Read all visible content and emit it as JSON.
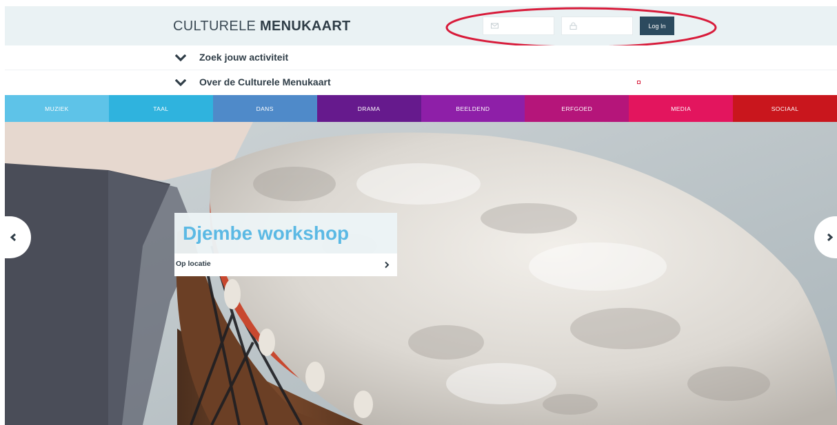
{
  "header": {
    "logo_light": "CULTURELE",
    "logo_bold": "MENUKAART",
    "login": {
      "email_icon": "envelope-icon",
      "password_icon": "lock-icon",
      "button_label": "Log In"
    }
  },
  "accordion": [
    {
      "label": "Zoek jouw activiteit",
      "icon": "chevron-down-icon"
    },
    {
      "label": "Over de Culturele Menukaart",
      "icon": "chevron-down-icon"
    }
  ],
  "categories": [
    {
      "label": "MUZIEK",
      "color": "#5ec3e8"
    },
    {
      "label": "TAAL",
      "color": "#2fb3de"
    },
    {
      "label": "DANS",
      "color": "#4f8ac9"
    },
    {
      "label": "DRAMA",
      "color": "#661a8d"
    },
    {
      "label": "BEELDEND",
      "color": "#8e1fa8"
    },
    {
      "label": "ERFGOED",
      "color": "#b5157a"
    },
    {
      "label": "MEDIA",
      "color": "#e3155e"
    },
    {
      "label": "SOCIAAL",
      "color": "#c9161d"
    }
  ],
  "hero": {
    "title": "Djembe workshop",
    "link_label": "Op locatie",
    "prev_icon": "chevron-left-icon",
    "next_icon": "chevron-right-icon"
  },
  "colors": {
    "header_bg": "#eaf2f4",
    "login_button": "#2c4a5e",
    "title_blue": "#5bb9e4",
    "annotation_red": "#d81b3a"
  }
}
